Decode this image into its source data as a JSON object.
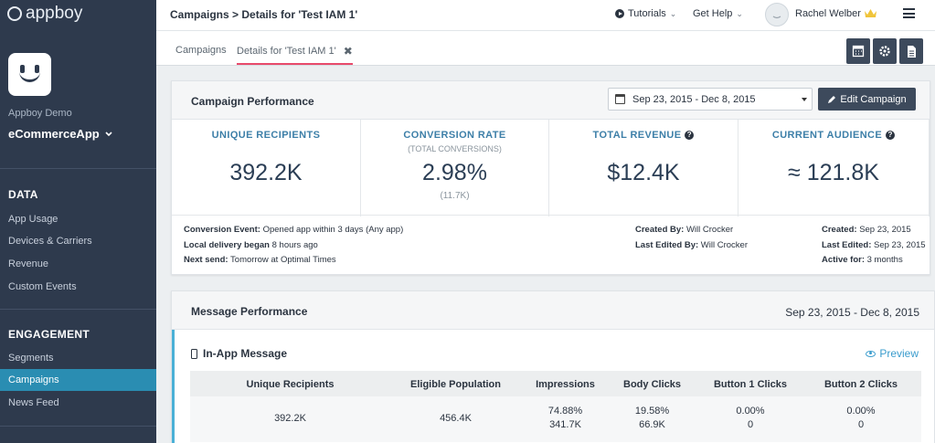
{
  "brand": {
    "name": "appboy"
  },
  "sidebar": {
    "company": "Appboy Demo",
    "app_name": "eCommerceApp",
    "sections": [
      {
        "title": "DATA",
        "items": [
          "App Usage",
          "Devices & Carriers",
          "Revenue",
          "Custom Events"
        ]
      },
      {
        "title": "ENGAGEMENT",
        "items": [
          "Segments",
          "Campaigns",
          "News Feed"
        ]
      }
    ],
    "active_item": "Campaigns"
  },
  "header": {
    "breadcrumb": "Campaigns > Details for 'Test IAM 1'",
    "tutorials": "Tutorials",
    "help": "Get Help",
    "user": "Rachel Welber"
  },
  "tabs": [
    {
      "label": "Campaigns"
    },
    {
      "label": "Details for 'Test IAM 1'"
    }
  ],
  "campaign_performance": {
    "title": "Campaign Performance",
    "date_range": "Sep 23, 2015 - Dec 8, 2015",
    "edit_label": "Edit Campaign",
    "metrics": [
      {
        "label": "UNIQUE RECIPIENTS",
        "sub": "",
        "value": "392.2K",
        "foot": ""
      },
      {
        "label": "CONVERSION RATE",
        "sub": "(TOTAL CONVERSIONS)",
        "value": "2.98%",
        "foot": "(11.7K)"
      },
      {
        "label": "TOTAL REVENUE",
        "sub": "",
        "value": "$12.4K",
        "foot": ""
      },
      {
        "label": "CURRENT AUDIENCE",
        "sub": "",
        "value": "≈ 121.8K",
        "foot": ""
      }
    ],
    "meta": {
      "conversion_event_label": "Conversion Event:",
      "conversion_event": "Opened app within 3 days (Any app)",
      "local_delivery_label": "Local delivery began",
      "local_delivery": "8 hours ago",
      "next_send_label": "Next send:",
      "next_send": "Tomorrow at Optimal Times",
      "created_by_label": "Created By:",
      "created_by": "Will Crocker",
      "last_edited_by_label": "Last Edited By:",
      "last_edited_by": "Will Crocker",
      "created_label": "Created:",
      "created": "Sep 23, 2015",
      "last_edited_label": "Last Edited:",
      "last_edited": "Sep 23, 2015",
      "active_for_label": "Active for:",
      "active_for": "3 months"
    }
  },
  "message_performance": {
    "title": "Message Performance",
    "date_range": "Sep 23, 2015 - Dec 8, 2015",
    "channel": "In-App Message",
    "preview_label": "Preview",
    "columns": [
      "Unique Recipients",
      "Eligible Population",
      "Impressions",
      "Body Clicks",
      "Button 1 Clicks",
      "Button 2 Clicks"
    ],
    "row": [
      {
        "line1": "392.2K",
        "line2": ""
      },
      {
        "line1": "456.4K",
        "line2": ""
      },
      {
        "line1": "74.88%",
        "line2": "341.7K"
      },
      {
        "line1": "19.58%",
        "line2": "66.9K"
      },
      {
        "line1": "0.00%",
        "line2": "0"
      },
      {
        "line1": "0.00%",
        "line2": "0"
      }
    ]
  },
  "colors": {
    "sidebar_bg": "#2e3a4d",
    "active_item": "#2a8db2",
    "metric_label": "#3d7fa8",
    "tab_underline": "#e84a6b",
    "accent_bar": "#4ab0d6"
  }
}
